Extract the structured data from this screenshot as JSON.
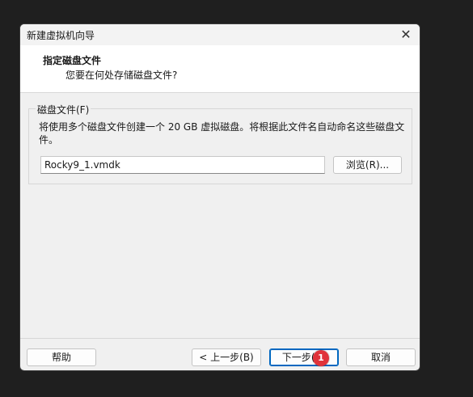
{
  "window": {
    "title": "新建虚拟机向导",
    "close_icon": "close-icon"
  },
  "header": {
    "title": "指定磁盘文件",
    "subtitle": "您要在何处存储磁盘文件?"
  },
  "disk_group": {
    "legend": "磁盘文件(F)",
    "description": "将使用多个磁盘文件创建一个 20 GB 虚拟磁盘。将根据此文件名自动命名这些磁盘文件。",
    "file_value": "Rocky9_1.vmdk",
    "browse_label": "浏览(R)..."
  },
  "footer": {
    "help_label": "帮助",
    "back_label": "< 上一步(B)",
    "next_label": "下一步(N)",
    "cancel_label": "取消"
  },
  "annotation": {
    "badge_number": "1",
    "badge_color": "#e0333a"
  }
}
